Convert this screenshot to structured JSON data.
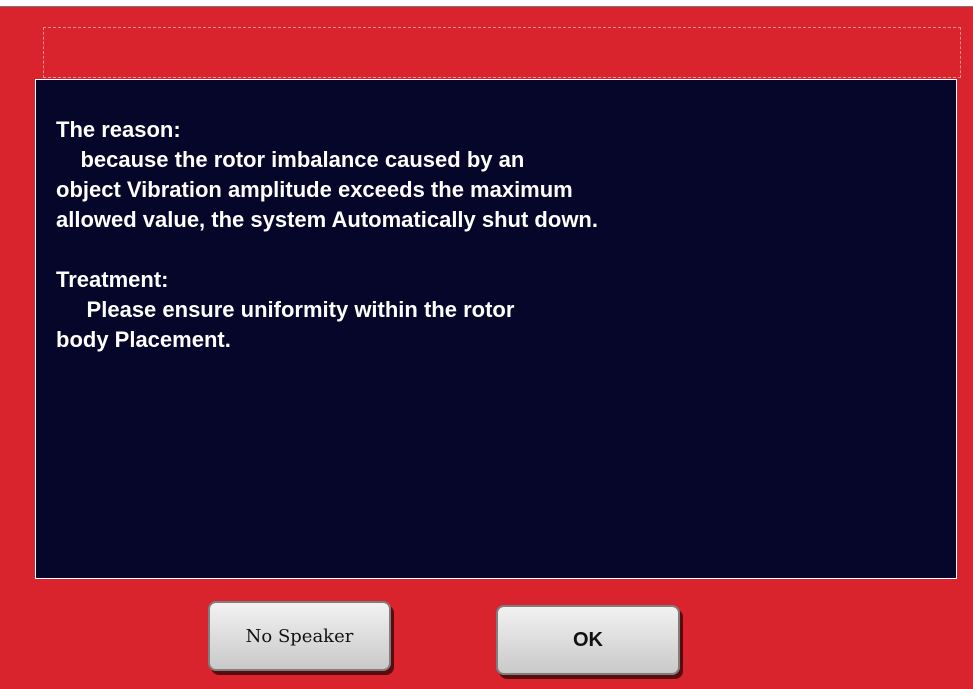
{
  "message": {
    "reason_heading": "The reason:",
    "reason_line1": "    because the rotor imbalance caused by an",
    "reason_line2": "object Vibration amplitude exceeds the maximum",
    "reason_line3": "allowed value, the system Automatically shut down.",
    "treatment_heading": "Treatment:",
    "treatment_line1": "     Please ensure uniformity within the rotor",
    "treatment_line2": "body Placement."
  },
  "buttons": {
    "no_speaker_label": "No Speaker",
    "ok_label": "OK"
  },
  "colors": {
    "frame_background": "#d9232d",
    "panel_background": "#06052a",
    "text": "#ffffff"
  }
}
